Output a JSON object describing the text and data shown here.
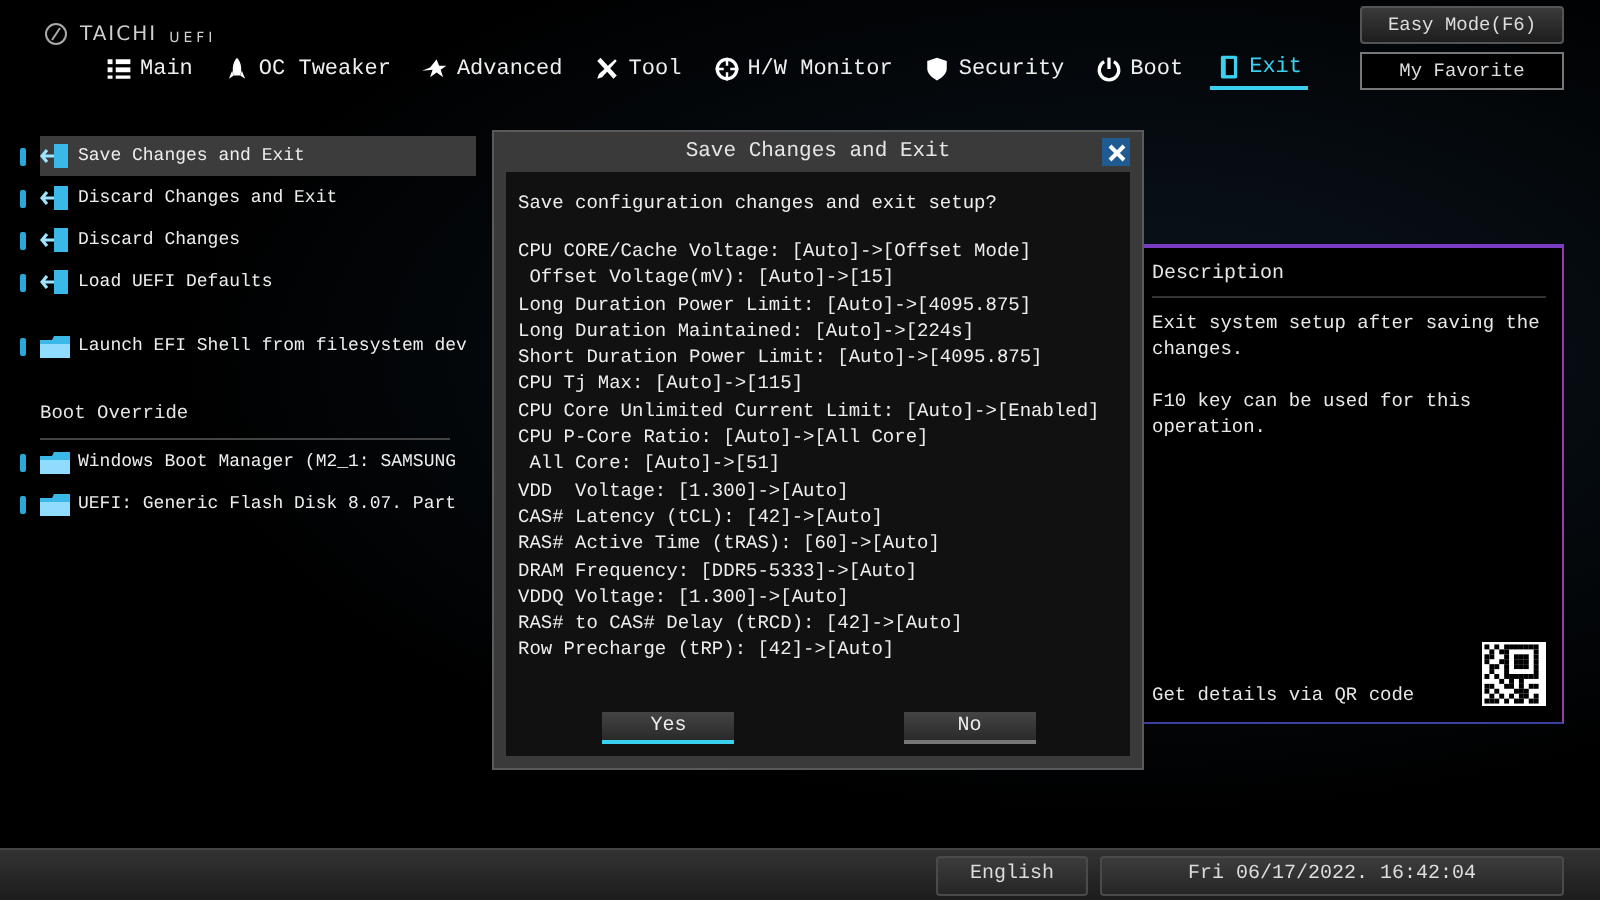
{
  "header": {
    "logo": {
      "brand": "TAICHI",
      "suffix": "UEFI"
    },
    "easy_mode_button": "Easy Mode(F6)",
    "favorite_button": "My Favorite",
    "tabs": [
      {
        "label": "Main",
        "selected": false
      },
      {
        "label": "OC Tweaker",
        "selected": false
      },
      {
        "label": "Advanced",
        "selected": false
      },
      {
        "label": "Tool",
        "selected": false
      },
      {
        "label": "H/W Monitor",
        "selected": false
      },
      {
        "label": "Security",
        "selected": false
      },
      {
        "label": "Boot",
        "selected": false
      },
      {
        "label": "Exit",
        "selected": true
      }
    ]
  },
  "menu": {
    "groups": [
      {
        "items": [
          {
            "kind": "exit",
            "label": "Save Changes and Exit",
            "selected": true
          },
          {
            "kind": "exit",
            "label": "Discard Changes and Exit",
            "selected": false
          },
          {
            "kind": "exit",
            "label": "Discard Changes",
            "selected": false
          },
          {
            "kind": "exit",
            "label": "Load UEFI Defaults",
            "selected": false
          }
        ]
      },
      {
        "items": [
          {
            "kind": "folder",
            "label": "Launch EFI Shell from filesystem dev",
            "selected": false
          }
        ]
      }
    ],
    "boot_override": {
      "title": "Boot Override",
      "items": [
        {
          "kind": "folder",
          "label": "Windows Boot Manager (M2_1: SAMSUNG",
          "selected": false
        },
        {
          "kind": "folder",
          "label": "UEFI: Generic Flash Disk 8.07. Part",
          "selected": false
        }
      ]
    }
  },
  "description": {
    "title": "Description",
    "paragraphs": [
      "Exit system setup after saving the changes.",
      "F10 key can be used for this operation."
    ],
    "qr_hint": "Get details via QR code"
  },
  "dialog": {
    "title": "Save Changes and Exit",
    "question": "Save configuration changes and exit setup?",
    "changes": [
      "CPU CORE/Cache Voltage: [Auto]->[Offset Mode]",
      " Offset Voltage(mV): [Auto]->[15]",
      "Long Duration Power Limit: [Auto]->[4095.875]",
      "Long Duration Maintained: [Auto]->[224s]",
      "Short Duration Power Limit: [Auto]->[4095.875]",
      "CPU Tj Max: [Auto]->[115]",
      "CPU Core Unlimited Current Limit: [Auto]->[Enabled]",
      "CPU P-Core Ratio: [Auto]->[All Core]",
      " All Core: [Auto]->[51]",
      "VDD  Voltage: [1.300]->[Auto]",
      "CAS# Latency (tCL): [42]->[Auto]",
      "RAS# Active Time (tRAS): [60]->[Auto]",
      "DRAM Frequency: [DDR5-5333]->[Auto]",
      "VDDQ Voltage: [1.300]->[Auto]",
      "RAS# to CAS# Delay (tRCD): [42]->[Auto]",
      "Row Precharge (tRP): [42]->[Auto]"
    ],
    "buttons": [
      {
        "label": "Yes",
        "selected": true
      },
      {
        "label": "No",
        "selected": false
      }
    ]
  },
  "status_bar": {
    "language": "English",
    "datetime": "Fri 06/17/2022. 16:42:04"
  }
}
